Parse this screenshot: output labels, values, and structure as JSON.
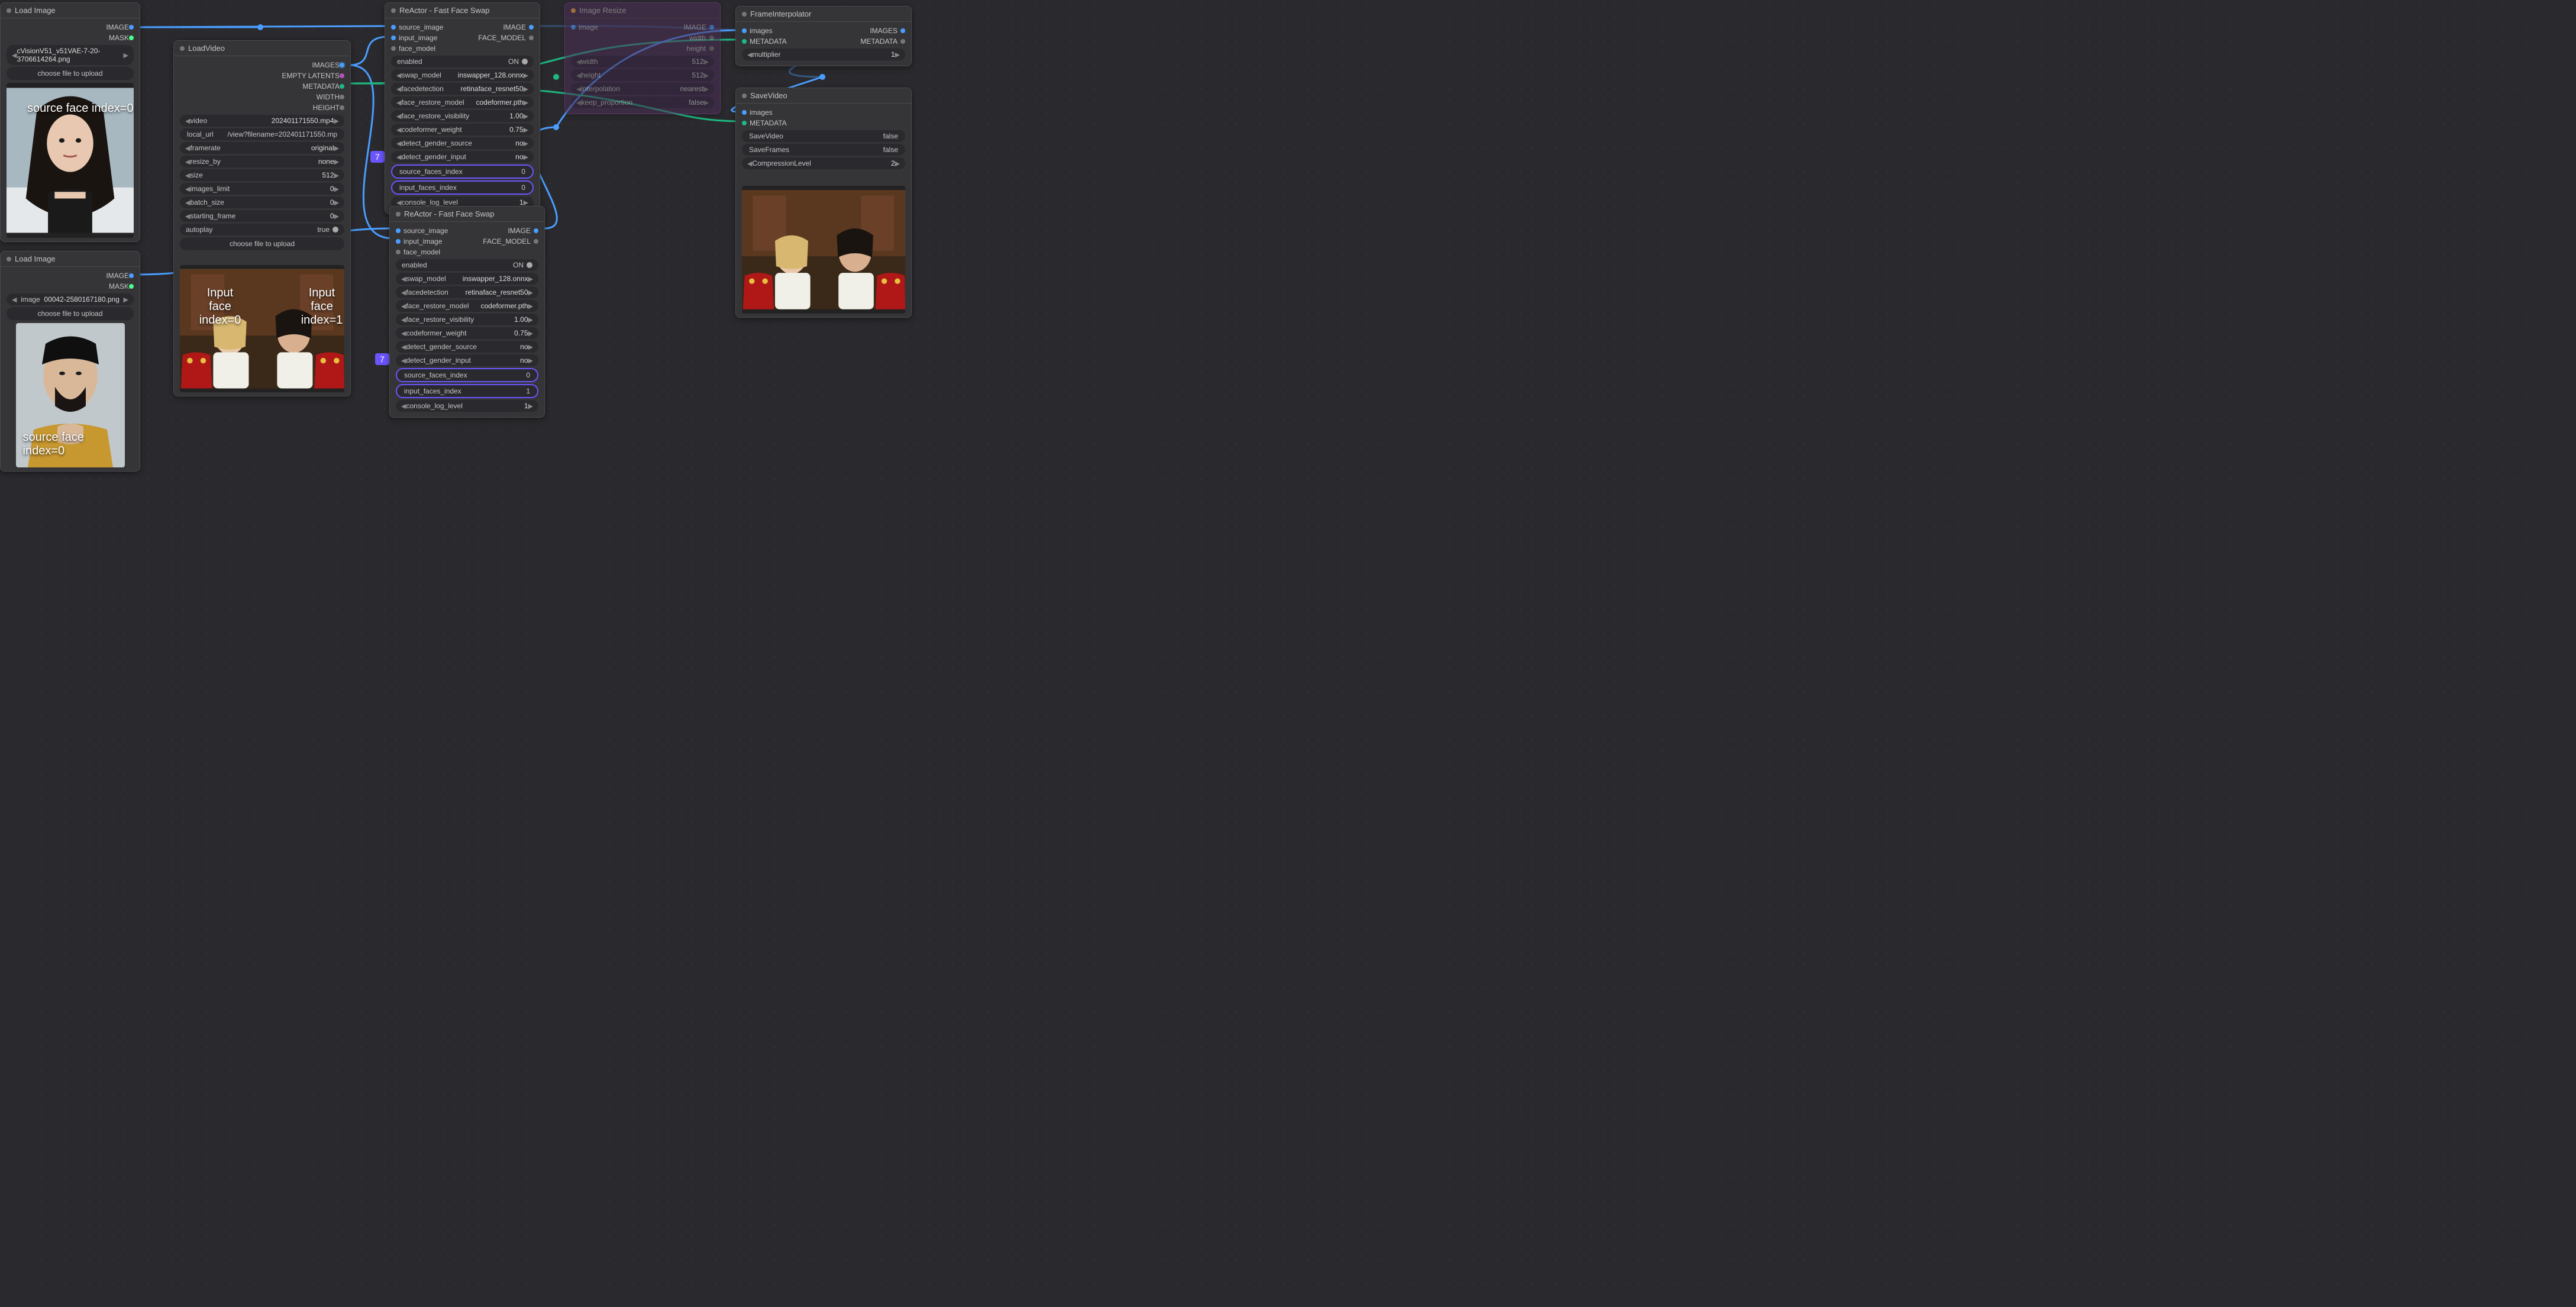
{
  "loadImage1": {
    "title": "Load Image",
    "image_out": "IMAGE",
    "mask_out": "MASK",
    "file": "cVisionV51_v51VAE-7-20-3706614264.png",
    "choose": "choose file to upload",
    "overlay": "source face index=0"
  },
  "loadImage2": {
    "title": "Load Image",
    "image_out": "IMAGE",
    "mask_out": "MASK",
    "image_label": "image",
    "file": "00042-2580167180.png",
    "choose": "choose file to upload",
    "overlay": "source face index=0"
  },
  "loadVideo": {
    "title": "LoadVideo",
    "outputs": {
      "images": "IMAGES",
      "empty": "EMPTY LATENTS",
      "metadata": "METADATA",
      "width": "WIDTH",
      "height": "HEIGHT"
    },
    "rows": [
      {
        "k": "video",
        "v": "202401171550.mp4"
      },
      {
        "k": "local_url",
        "v": "/view?filename=202401171550.mp"
      },
      {
        "k": "framerate",
        "v": "original"
      },
      {
        "k": "resize_by",
        "v": "none"
      },
      {
        "k": "size",
        "v": "512"
      },
      {
        "k": "images_limit",
        "v": "0"
      },
      {
        "k": "batch_size",
        "v": "0"
      },
      {
        "k": "starting_frame",
        "v": "0"
      }
    ],
    "autoplay": {
      "k": "autoplay",
      "v": "true"
    },
    "choose": "choose file to upload",
    "overlay0": "Input face index=0",
    "overlay1": "Input face index=1"
  },
  "reactor1": {
    "title": "ReActor - Fast Face Swap",
    "in": {
      "source": "source_image",
      "input": "input_image",
      "face": "face_model"
    },
    "out": {
      "image": "IMAGE",
      "face": "FACE_MODEL"
    },
    "enabled": "enabled",
    "on": "ON",
    "rows": [
      {
        "k": "swap_model",
        "v": "inswapper_128.onnx"
      },
      {
        "k": "facedetection",
        "v": "retinaface_resnet50"
      },
      {
        "k": "face_restore_model",
        "v": "codeformer.pth"
      },
      {
        "k": "face_restore_visibility",
        "v": "1.00"
      },
      {
        "k": "codeformer_weight",
        "v": "0.75"
      },
      {
        "k": "detect_gender_source",
        "v": "no"
      },
      {
        "k": "detect_gender_input",
        "v": "no"
      }
    ],
    "sfaces": {
      "k": "source_faces_index",
      "v": "0"
    },
    "ifaces": {
      "k": "input_faces_index",
      "v": "0"
    },
    "console": {
      "k": "console_log_level",
      "v": "1"
    },
    "badge": "7"
  },
  "reactor2": {
    "title": "ReActor - Fast Face Swap",
    "in": {
      "source": "source_image",
      "input": "input_image",
      "face": "face_model"
    },
    "out": {
      "image": "IMAGE",
      "face": "FACE_MODEL"
    },
    "enabled": "enabled",
    "on": "ON",
    "rows": [
      {
        "k": "swap_model",
        "v": "inswapper_128.onnx"
      },
      {
        "k": "facedetection",
        "v": "retinaface_resnet50"
      },
      {
        "k": "face_restore_model",
        "v": "codeformer.pth"
      },
      {
        "k": "face_restore_visibility",
        "v": "1.00"
      },
      {
        "k": "codeformer_weight",
        "v": "0.75"
      },
      {
        "k": "detect_gender_source",
        "v": "no"
      },
      {
        "k": "detect_gender_input",
        "v": "no"
      }
    ],
    "sfaces": {
      "k": "source_faces_index",
      "v": "0"
    },
    "ifaces": {
      "k": "input_faces_index",
      "v": "1"
    },
    "console": {
      "k": "console_log_level",
      "v": "1"
    },
    "badge": "7"
  },
  "resize": {
    "title": "Image Resize",
    "in": "image",
    "out": "IMAGE",
    "rows": [
      {
        "k": "width",
        "v": ""
      },
      {
        "k": "height",
        "v": ""
      },
      {
        "k": "width",
        "v": "512"
      },
      {
        "k": "height",
        "v": "512"
      },
      {
        "k": "interpolation",
        "v": "nearest"
      },
      {
        "k": "keep_proportion",
        "v": "false"
      }
    ]
  },
  "frameInterp": {
    "title": "FrameInterpolator",
    "in": {
      "images": "images",
      "metadata": "METADATA"
    },
    "out": {
      "images": "IMAGES",
      "metadata": "METADATA"
    },
    "mult": {
      "k": "multiplier",
      "v": "1"
    }
  },
  "saveVideo": {
    "title": "SaveVideo",
    "in": {
      "images": "images",
      "metadata": "METADATA"
    },
    "rows": [
      {
        "k": "SaveVideo",
        "v": "false"
      },
      {
        "k": "SaveFrames",
        "v": "false"
      }
    ],
    "comp": {
      "k": "CompressionLevel",
      "v": "2"
    }
  }
}
